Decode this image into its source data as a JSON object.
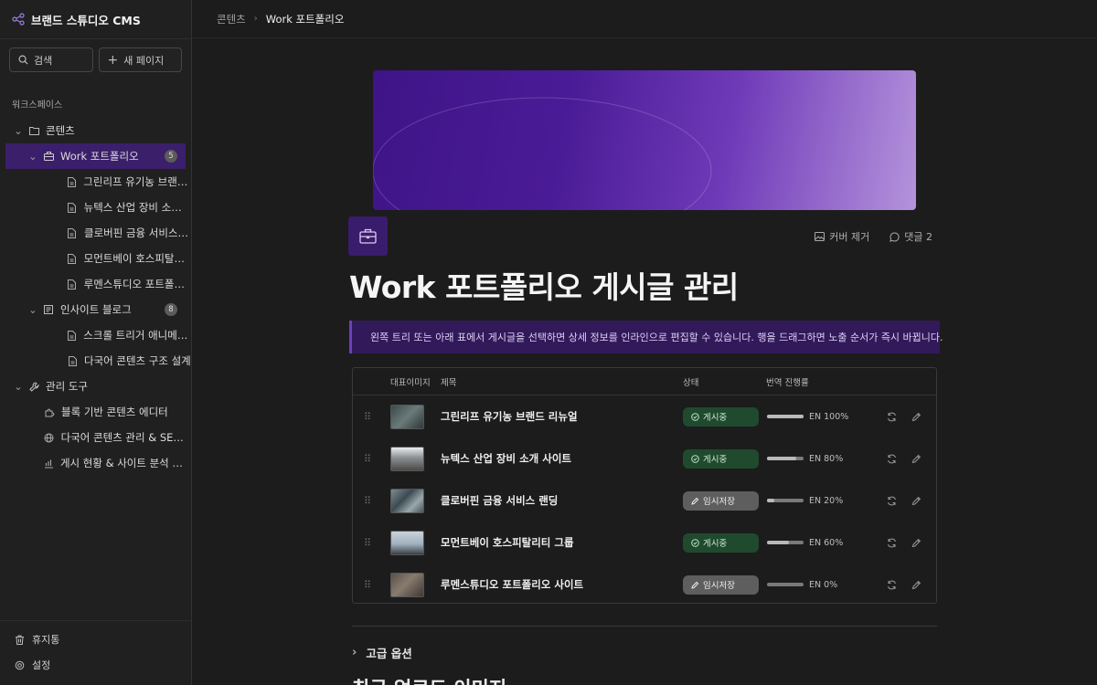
{
  "app": {
    "title": "브랜드 스튜디오 CMS"
  },
  "sidebar": {
    "search_label": "검색",
    "new_page_label": "새 페이지",
    "workspace_label": "워크스페이스",
    "items": [
      {
        "label": "콘텐츠",
        "icon": "folder-icon"
      },
      {
        "label": "Work 포트폴리오",
        "icon": "briefcase-icon",
        "count": "5"
      },
      {
        "label": "그린리프 유기농 브랜드...",
        "icon": "file-icon"
      },
      {
        "label": "뉴텍스 산업 장비 소개 ...",
        "icon": "file-icon"
      },
      {
        "label": "클로버핀 금융 서비스 ...",
        "icon": "file-icon"
      },
      {
        "label": "모먼트베이 호스피탈리...",
        "icon": "file-icon"
      },
      {
        "label": "루멘스튜디오 포트폴리...",
        "icon": "file-icon"
      },
      {
        "label": "인사이트 블로그",
        "icon": "newspaper-icon",
        "count": "8"
      },
      {
        "label": "스크롤 트리거 애니메이...",
        "icon": "file-icon"
      },
      {
        "label": "다국어 콘텐츠 구조 설계",
        "icon": "file-icon"
      },
      {
        "label": "관리 도구",
        "icon": "wrench-icon"
      },
      {
        "label": "블록 기반 콘텐츠 에디터",
        "icon": "puzzle-icon"
      },
      {
        "label": "다국어 콘텐츠 관리 & SEO ...",
        "icon": "globe-icon"
      },
      {
        "label": "게시 현황 & 사이트 분석 대시...",
        "icon": "chart-icon"
      }
    ],
    "trash_label": "휴지통",
    "settings_label": "설정"
  },
  "breadcrumb": {
    "parent": "콘텐츠",
    "current": "Work 포트폴리오"
  },
  "page": {
    "remove_cover_label": "커버 제거",
    "comments_label": "댓글 2",
    "title": "Work 포트폴리오 게시글 관리",
    "callout": "왼쪽 트리 또는 아래 표에서 게시글을 선택하면 상세 정보를 인라인으로 편집할 수 있습니다. 행을 드래그하면 노출 순서가 즉시 바뀝니다.",
    "accent": "#3a1c6c"
  },
  "table": {
    "headers": {
      "thumb": "대표이미지",
      "title": "제목",
      "status": "상태",
      "progress": "번역 진행률"
    },
    "rows": [
      {
        "title": "그린리프 유기농 브랜드 리뉴얼",
        "status": "게시중",
        "status_kind": "pub",
        "progress_label": "EN 100%",
        "progress": 1.0
      },
      {
        "title": "뉴텍스 산업 장비 소개 사이트",
        "status": "게시중",
        "status_kind": "pub",
        "progress_label": "EN 80%",
        "progress": 0.8
      },
      {
        "title": "클로버핀 금융 서비스 랜딩",
        "status": "임시저장",
        "status_kind": "draft",
        "progress_label": "EN 20%",
        "progress": 0.2
      },
      {
        "title": "모먼트베이 호스피탈리티 그룹",
        "status": "게시중",
        "status_kind": "pub",
        "progress_label": "EN 60%",
        "progress": 0.6
      },
      {
        "title": "루멘스튜디오 포트폴리오 사이트",
        "status": "임시저장",
        "status_kind": "draft",
        "progress_label": "EN 0%",
        "progress": 0.0
      }
    ]
  },
  "advanced_label": "고급 옵션",
  "recent_heading": "최근 업로드 이미지"
}
